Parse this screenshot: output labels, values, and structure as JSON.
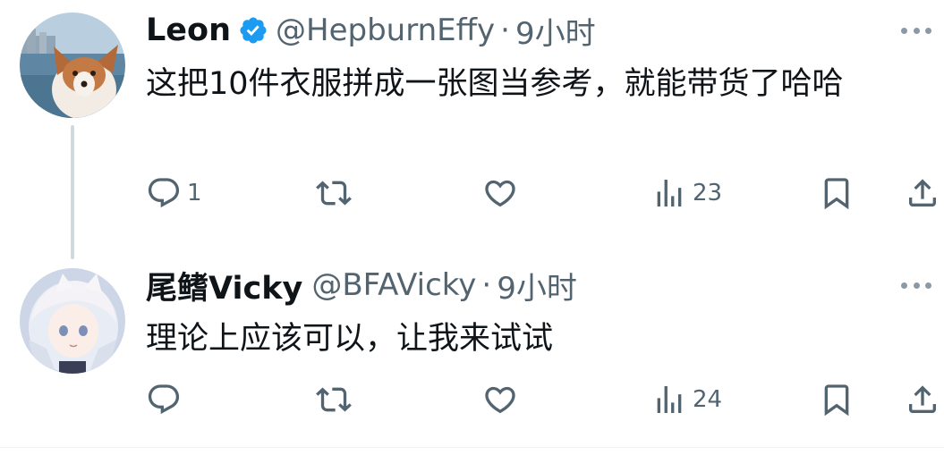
{
  "colors": {
    "text": "#0f1419",
    "secondary": "#536471",
    "verified": "#1d9bf0"
  },
  "tweets": [
    {
      "name": "Leon",
      "verified": true,
      "handle": "@HepburnEffy",
      "separator": "·",
      "time": "9小时",
      "text": "这把10件衣服拼成一张图当参考，就能带货了哈哈",
      "avatar": "dog-by-water-avatar",
      "stats": {
        "replies": "1",
        "retweets": "",
        "likes": "",
        "views": "23"
      }
    },
    {
      "name": "尾鳍Vicky",
      "verified": false,
      "handle": "@BFAVicky",
      "separator": "·",
      "time": "9小时",
      "text": "理论上应该可以，让我来试试",
      "avatar": "anime-girl-avatar",
      "stats": {
        "replies": "",
        "retweets": "",
        "likes": "",
        "views": "24"
      }
    }
  ]
}
